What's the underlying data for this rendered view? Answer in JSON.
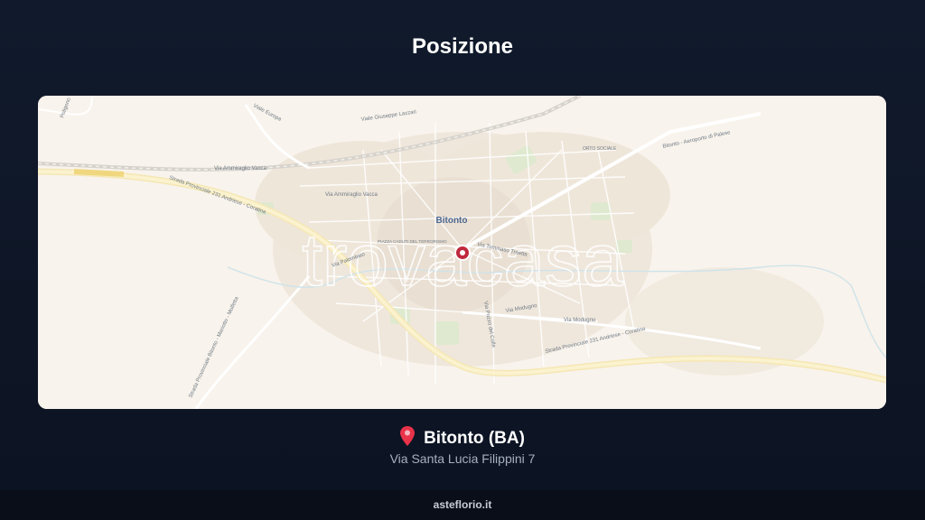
{
  "header": {
    "title": "Posizione"
  },
  "map": {
    "city_label": "Bitonto",
    "watermark": "trovacasa",
    "street_labels": {
      "viale_europa": "Viale Europa",
      "viale_giuseppe_lazzari": "Viale Giuseppe Lazzari",
      "via_ammiraglio_vacca_1": "Via Ammiraglio Vacca",
      "via_ammiraglio_vacca_2": "Via Ammiraglio Vacca",
      "strada_231": "Strada Provinciale 231 Andriese - Coratina",
      "strada_231_east": "Strada Provinciale 231 Andriese - Coratina",
      "via_palombaio": "Via Palombaio",
      "piazza_caduti": "PIAZZA CADUTI DEL TERRORISMO",
      "via_traetta": "Via Tommaso Traetta",
      "via_modugno_1": "Via Modugno",
      "via_modugno_2": "Via Modugno",
      "via_colle": "Via Pozzo del Colle",
      "strada_mariotto": "Strada Provinciale Bitonto - Mariotto - Molfetta",
      "orto_sociale": "ORTO SOCIALE",
      "aeroporto": "Bitonto - Aeroporto di Palese",
      "poligono": "Poligono"
    },
    "accent_color": "#c0283d"
  },
  "location": {
    "pin_icon": "map-pin-icon",
    "city": "Bitonto (BA)",
    "address": "Via Santa Lucia Filippini 7"
  },
  "footer": {
    "site": "asteflorio.it"
  }
}
